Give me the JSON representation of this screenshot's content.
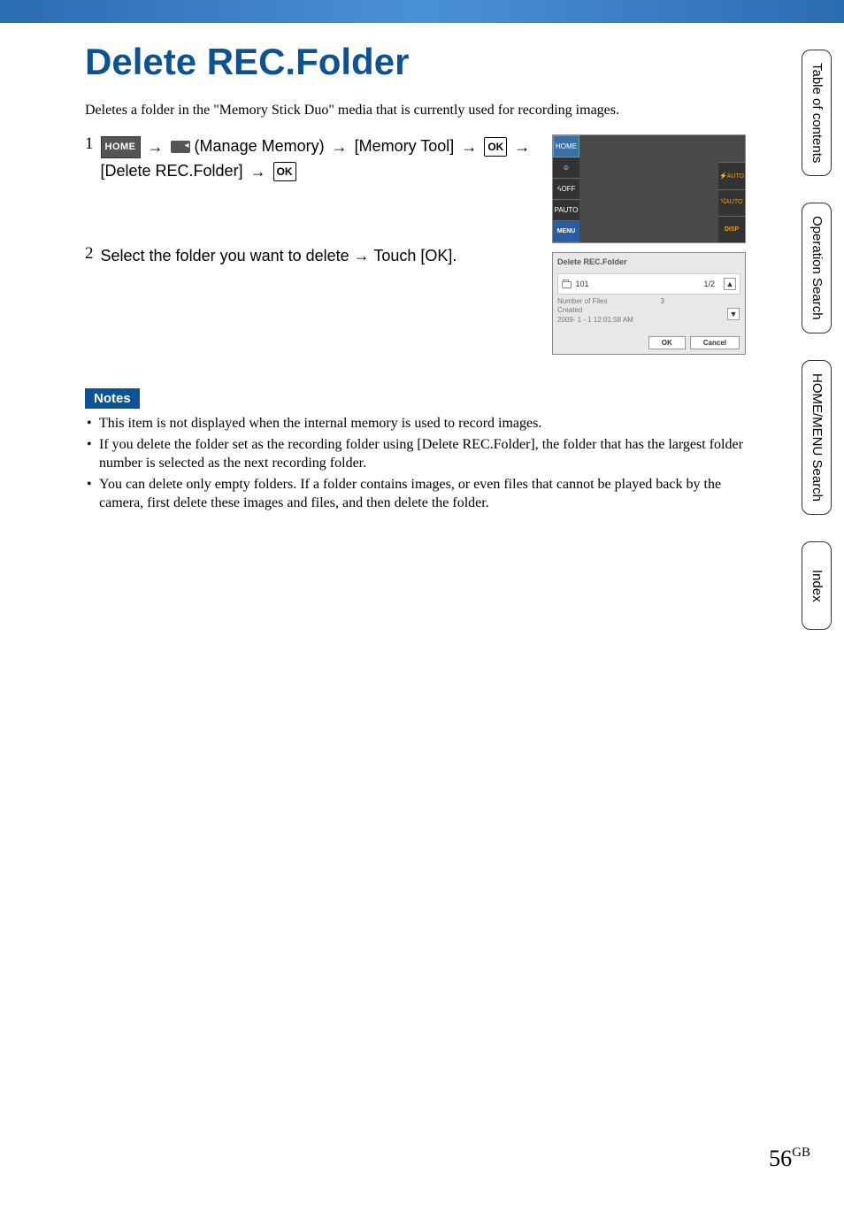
{
  "page": {
    "title": "Delete REC.Folder",
    "intro": "Deletes a folder in the \"Memory Stick Duo\" media that is currently used for recording images.",
    "pageNumber": "56",
    "pageSuffix": "GB"
  },
  "steps": {
    "1": {
      "number": "1",
      "home": "HOME",
      "manageMemory": " (Manage Memory) ",
      "memoryTool": " [Memory Tool] ",
      "ok1": "OK",
      "deleteRec": " [Delete REC.Folder] ",
      "ok2": "OK"
    },
    "2": {
      "number": "2",
      "text": "Select the folder you want to delete → Touch [OK]."
    }
  },
  "screen1": {
    "home": "HOME",
    "face": "☺",
    "off": "ᔦOFF",
    "pauto": "PAUTO",
    "menu": "MENU",
    "flashAuto": "⚡AUTO",
    "jauto": "⤭AUTO",
    "disp": "DISP"
  },
  "screen2": {
    "title": "Delete REC.Folder",
    "folderNum": "101",
    "pager": "1/2",
    "filesLabel": "Number of Files",
    "filesCount": "3",
    "createdLabel": "Created",
    "createdDate": "2009- 1 - 1 12:01:58 AM",
    "ok": "OK",
    "cancel": "Cancel"
  },
  "notes": {
    "label": "Notes",
    "items": [
      "This item is not displayed when the internal memory is used to record images.",
      "If you delete the folder set as the recording folder using [Delete REC.Folder], the folder that has the largest folder number is selected as the next recording folder.",
      "You can delete only empty folders. If a folder contains images, or even files that cannot be played back by the camera, first delete these images and files, and then delete the folder."
    ]
  },
  "sideTabs": {
    "toc": "Table of contents",
    "operation": "Operation Search",
    "homeMenu": "HOME/MENU Search",
    "index": "Index"
  }
}
